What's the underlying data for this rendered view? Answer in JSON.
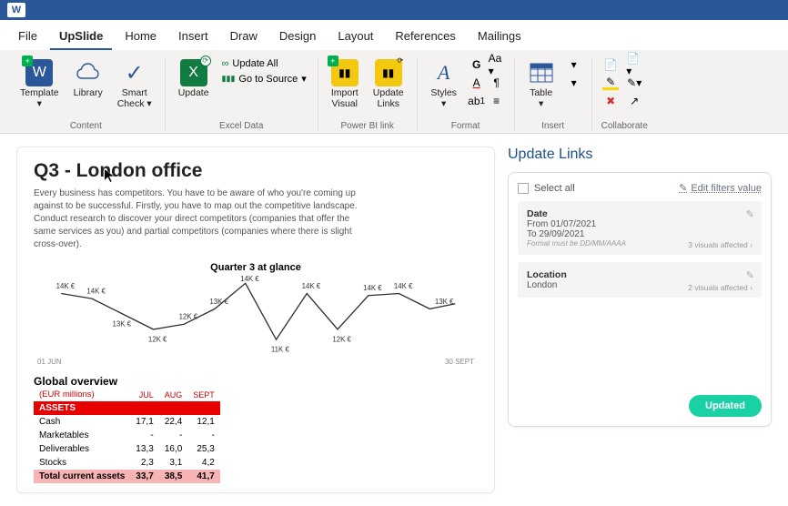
{
  "app": {
    "word_badge": "W"
  },
  "tabs": {
    "file": "File",
    "upslide": "UpSlide",
    "home": "Home",
    "insert": "Insert",
    "draw": "Draw",
    "design": "Design",
    "layout": "Layout",
    "references": "References",
    "mailings": "Mailings"
  },
  "ribbon": {
    "content": {
      "template": "Template",
      "library": "Library",
      "smart_check": "Smart\nCheck",
      "label": "Content"
    },
    "excel": {
      "update": "Update",
      "update_all": "Update All",
      "go_to_source": "Go to Source",
      "label": "Excel Data"
    },
    "pbi": {
      "import_visual": "Import\nVisual",
      "update_links": "Update\nLinks",
      "label": "Power BI link"
    },
    "format": {
      "styles": "Styles",
      "label": "Format"
    },
    "insert": {
      "table": "Table",
      "label": "Insert"
    },
    "collab": {
      "label": "Collaborate"
    }
  },
  "doc": {
    "title": "Q3 - London office",
    "paragraph": "Every business has competitors. You have to be aware of who you're coming up against to be successful. Firstly, you have to map out the competitive landscape. Conduct research to discover your direct competitors (companies that offer the same services as you) and partial competitors (companies where there is slight cross-over).",
    "chart_title": "Quarter 3 at glance",
    "x_start": "01 JUN",
    "x_end": "30 SEPT",
    "overview_title": "Global overview",
    "units_label": "(EUR millions)",
    "cols": {
      "jul": "JUL",
      "aug": "AUG",
      "sept": "SEPT"
    },
    "assets_header": "ASSETS",
    "rows": {
      "cash": {
        "label": "Cash",
        "jul": "17,1",
        "aug": "22,4",
        "sept": "12,1"
      },
      "marketables": {
        "label": "Marketables",
        "jul": "-",
        "aug": "-",
        "sept": "-"
      },
      "deliverables": {
        "label": "Deliverables",
        "jul": "13,3",
        "aug": "16,0",
        "sept": "25,3"
      },
      "stocks": {
        "label": "Stocks",
        "jul": "2,3",
        "aug": "3,1",
        "sept": "4,2"
      },
      "total": {
        "label": "Total current assets",
        "jul": "33,7",
        "aug": "38,5",
        "sept": "41,7"
      }
    }
  },
  "chart_data": {
    "type": "line",
    "title": "Quarter 3 at glance",
    "xlabel": "",
    "ylabel": "",
    "x_range": [
      "01 JUN",
      "30 SEPT"
    ],
    "labels": [
      "14K €",
      "14K €",
      "13K €",
      "12K €",
      "12K €",
      "13K €",
      "14K €",
      "11K €",
      "14K €",
      "12K €",
      "14K €",
      "14K €",
      "13K €"
    ],
    "values": [
      14,
      14,
      13,
      12,
      12,
      13,
      14,
      11,
      14,
      12,
      14,
      14,
      13
    ],
    "ylim": [
      10,
      15
    ]
  },
  "side": {
    "title": "Update Links",
    "select_all": "Select all",
    "edit_filters": "Edit filters value",
    "date_card": {
      "label": "Date",
      "from": "From 01/07/2021",
      "to": "To 29/09/2021",
      "note": "Format must be DD/MM/AAAA",
      "affected": "3 visuals affected"
    },
    "location_card": {
      "label": "Location",
      "value": "London",
      "affected": "2 visuals affected"
    },
    "button": "Updated"
  }
}
